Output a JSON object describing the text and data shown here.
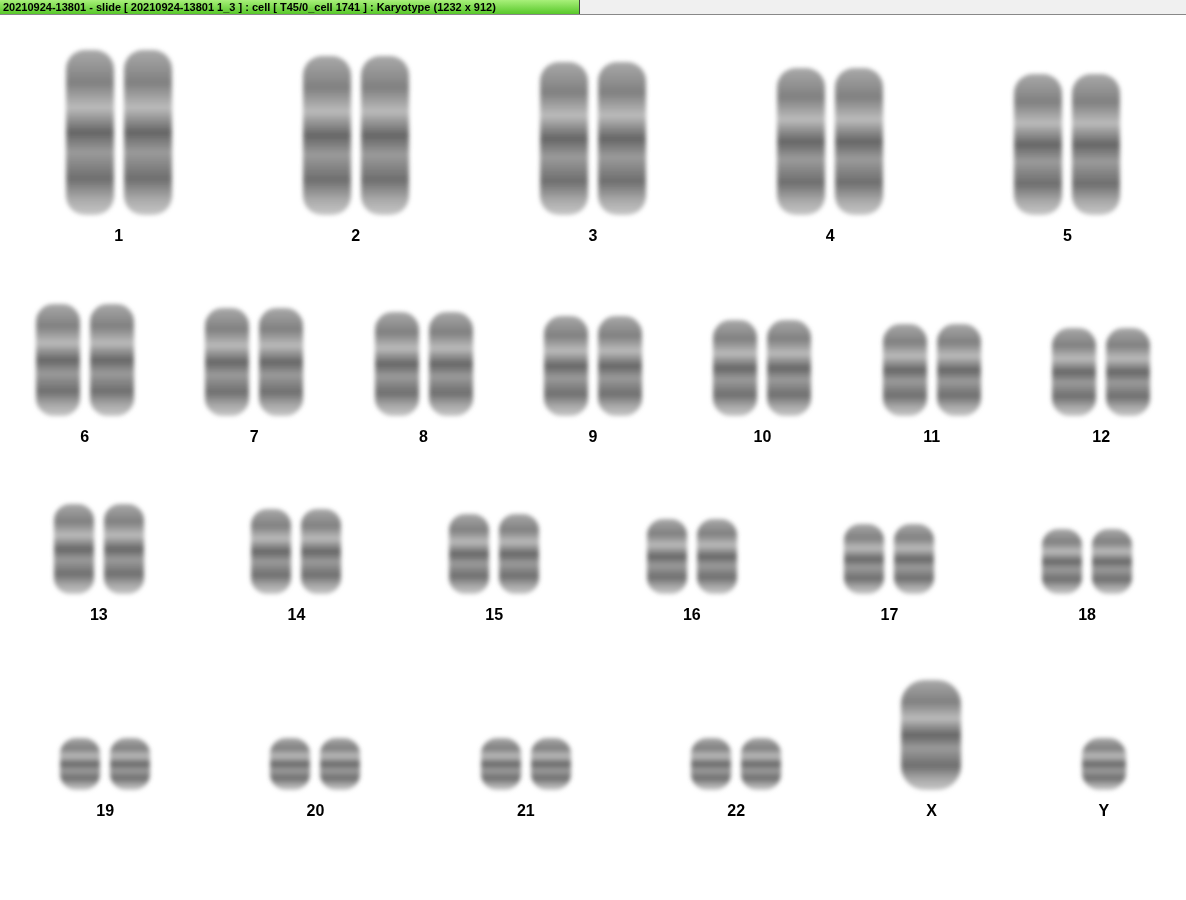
{
  "window": {
    "title": "20210924-13801 - slide [ 20210924-13801 1_3 ] : cell [ T45/0_cell 1741 ] : Karyotype  (1232 x 912)"
  },
  "karyotype_rows": [
    {
      "items": [
        {
          "label": "1",
          "kind": "pair"
        },
        {
          "label": "2",
          "kind": "pair"
        },
        {
          "label": "3",
          "kind": "pair"
        },
        {
          "label": "4",
          "kind": "pair"
        },
        {
          "label": "5",
          "kind": "pair"
        }
      ]
    },
    {
      "items": [
        {
          "label": "6",
          "kind": "pair"
        },
        {
          "label": "7",
          "kind": "pair"
        },
        {
          "label": "8",
          "kind": "pair"
        },
        {
          "label": "9",
          "kind": "pair"
        },
        {
          "label": "10",
          "kind": "pair"
        },
        {
          "label": "11",
          "kind": "pair"
        },
        {
          "label": "12",
          "kind": "pair"
        }
      ]
    },
    {
      "items": [
        {
          "label": "13",
          "kind": "pair"
        },
        {
          "label": "14",
          "kind": "pair"
        },
        {
          "label": "15",
          "kind": "pair"
        },
        {
          "label": "16",
          "kind": "pair"
        },
        {
          "label": "17",
          "kind": "pair"
        },
        {
          "label": "18",
          "kind": "pair"
        }
      ]
    },
    {
      "items": [
        {
          "label": "19",
          "kind": "pair"
        },
        {
          "label": "20",
          "kind": "pair"
        },
        {
          "label": "21",
          "kind": "pair"
        },
        {
          "label": "22",
          "kind": "pair"
        },
        {
          "label": "X",
          "kind": "single"
        },
        {
          "label": "Y",
          "kind": "single"
        }
      ]
    }
  ]
}
